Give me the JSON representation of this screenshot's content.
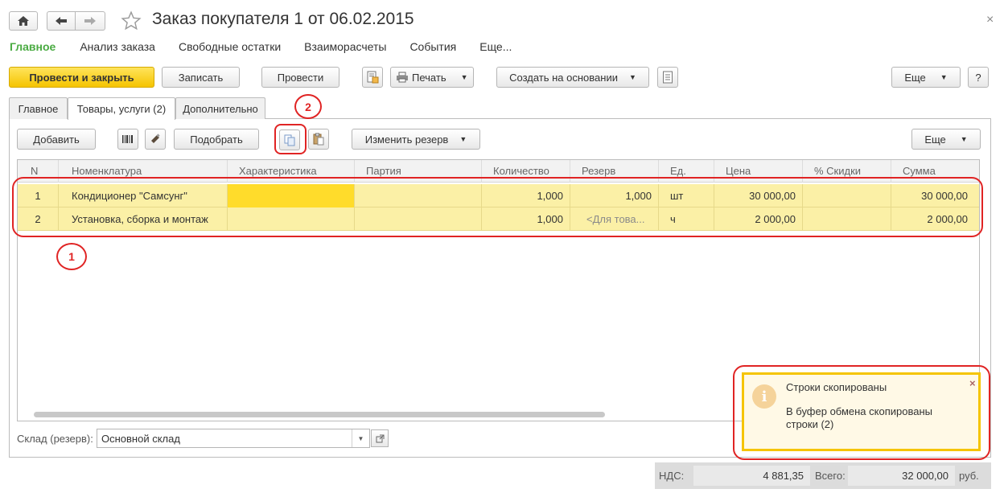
{
  "window": {
    "title": "Заказ покупателя 1 от 06.02.2015",
    "close_glyph": "×"
  },
  "sections": [
    {
      "label": "Главное",
      "active": true
    },
    {
      "label": "Анализ заказа",
      "active": false
    },
    {
      "label": "Свободные остатки",
      "active": false
    },
    {
      "label": "Взаиморасчеты",
      "active": false
    },
    {
      "label": "События",
      "active": false
    },
    {
      "label": "Еще...",
      "active": false
    }
  ],
  "toolbar": {
    "post_close": "Провести и закрыть",
    "save": "Записать",
    "post": "Провести",
    "print": "Печать",
    "create_based": "Создать на основании",
    "more": "Еще",
    "help": "?"
  },
  "tabs": [
    {
      "label": "Главное",
      "active": false
    },
    {
      "label": "Товары, услуги (2)",
      "active": true
    },
    {
      "label": "Дополнительно",
      "active": false
    }
  ],
  "grid_toolbar": {
    "add": "Добавить",
    "pick": "Подобрать",
    "change_reserve": "Изменить резерв",
    "more": "Еще"
  },
  "table": {
    "columns": [
      "N",
      "Номенклатура",
      "Характеристика",
      "Партия",
      "Количество",
      "Резерв",
      "Ед.",
      "Цена",
      "% Скидки",
      "Сумма"
    ],
    "rows": [
      {
        "n": "1",
        "item": "Кондиционер \"Самсунг\"",
        "characteristic": "",
        "batch": "",
        "qty": "1,000",
        "reserve": "1,000",
        "unit": "шт",
        "price": "30 000,00",
        "discount": "",
        "sum": "30 000,00"
      },
      {
        "n": "2",
        "item": "Установка, сборка и монтаж",
        "characteristic": "",
        "batch": "",
        "qty": "1,000",
        "reserve": "<Для това...",
        "unit": "ч",
        "price": "2 000,00",
        "discount": "",
        "sum": "2 000,00"
      }
    ]
  },
  "warehouse": {
    "label": "Склад (резерв):",
    "value": "Основной склад"
  },
  "totals": {
    "vat_label": "НДС:",
    "vat_value": "4 881,35",
    "total_label": "Всего:",
    "total_value": "32 000,00",
    "currency": "руб."
  },
  "notification": {
    "title": "Строки скопированы",
    "text": "В буфер обмена скопированы строки (2)",
    "close": "×"
  },
  "annotations": {
    "marker_1": "1",
    "marker_2": "2"
  },
  "colors": {
    "accent_green": "#4aab42",
    "primary_yellow": "#f5c400",
    "row_highlight": "#fbf0a6",
    "annotation_red": "#e02424"
  }
}
